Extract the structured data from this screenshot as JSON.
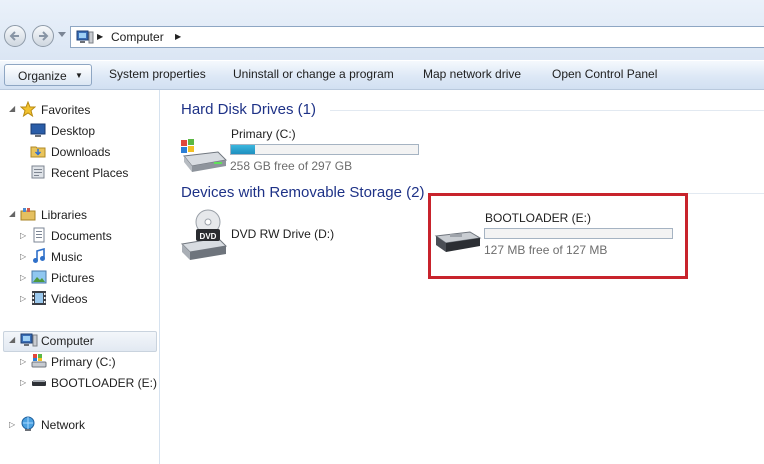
{
  "address": {
    "path": [
      "Computer"
    ],
    "back_icon": "back-arrow-icon",
    "forward_icon": "forward-arrow-icon"
  },
  "toolbar": {
    "organize": "Organize",
    "items": [
      "System properties",
      "Uninstall or change a program",
      "Map network drive",
      "Open Control Panel"
    ]
  },
  "nav": {
    "favorites": "Favorites",
    "favorites_items": [
      "Desktop",
      "Downloads",
      "Recent Places"
    ],
    "libraries": "Libraries",
    "libraries_items": [
      "Documents",
      "Music",
      "Pictures",
      "Videos"
    ],
    "computer": "Computer",
    "computer_items": [
      "Primary (C:)",
      "BOOTLOADER (E:)"
    ],
    "network": "Network"
  },
  "content": {
    "hdd_group": "Hard Disk Drives (1)",
    "removable_group": "Devices with Removable Storage (2)",
    "drives": {
      "c": {
        "name": "Primary (C:)",
        "free": "258 GB free of 297 GB",
        "used_fraction": 0.13
      },
      "d": {
        "name": "DVD RW Drive (D:)"
      },
      "e": {
        "name": "BOOTLOADER (E:)",
        "free": "127 MB free of 127 MB",
        "used_fraction": 0.0
      }
    }
  },
  "colors": {
    "group_header": "#1e3287",
    "highlight": "#c8232c",
    "bar_fill": "#26a0da"
  }
}
